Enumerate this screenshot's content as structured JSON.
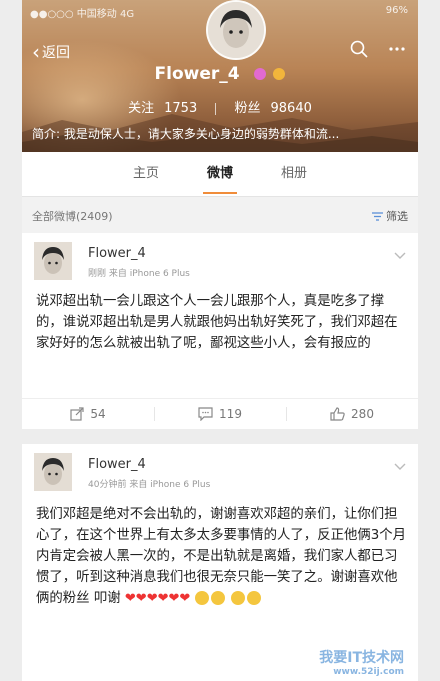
{
  "status_bar": {
    "carrier": "●●○○○ 中国移动 4G",
    "time": "16",
    "battery": "96%"
  },
  "header": {
    "back_label": "返回",
    "username": "Flower_4",
    "follow_label": "关注",
    "follow_count": "1753",
    "fans_label": "粉丝",
    "fans_count": "98640",
    "intro": "简介: 我是动保人士，请大家多关心身边的弱势群体和流..."
  },
  "tabs": [
    {
      "label": "主页",
      "active": false
    },
    {
      "label": "微博",
      "active": true
    },
    {
      "label": "相册",
      "active": false
    }
  ],
  "feed": {
    "count_label": "全部微博(2409)",
    "filter_label": "筛选"
  },
  "posts": [
    {
      "name": "Flower_4",
      "meta": "刚刚  来自 iPhone 6 Plus",
      "text": "说邓超出轨一会儿跟这个人一会儿跟那个人，真是吃多了撑的，谁说邓超出轨是男人就跟他妈出轨好笑死了，我们邓超在家好好的怎么就被出轨了呢，鄙视这些小人，会有报应的",
      "reposts": "54",
      "comments": "119",
      "likes": "280"
    },
    {
      "name": "Flower_4",
      "meta": "40分钟前  来自 iPhone 6 Plus",
      "text": "我们邓超是绝对不会出轨的，谢谢喜欢邓超的亲们，让你们担心了，在这个世界上有太多太多要事情的人了，反正他俩3个月内肯定会被人黑一次的，不是出轨就是离婚，我们家人都已习惯了，听到这种消息我们也很无奈只能一笑了之。谢谢喜欢他俩的粉丝 叩谢"
    }
  ],
  "watermark": {
    "main": "我要IT技术网",
    "sub": "www.52ij.com"
  },
  "colors": {
    "accent": "#f08c3a",
    "heart": "#e33333"
  }
}
